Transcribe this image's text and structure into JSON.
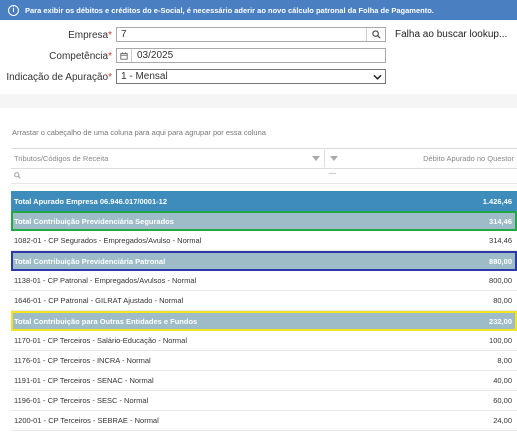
{
  "banner": {
    "icon": "info-icon",
    "text": "Para exibir os débitos e créditos do e-Social, é necessário aderir ao novo cálculo patronal da Folha de Pagamento."
  },
  "form": {
    "empresa_label": "Empresa",
    "empresa_value": "7",
    "lookup_error": "Falha ao buscar lookup...",
    "competencia_label": "Competência",
    "competencia_value": "03/2025",
    "apuracao_label": "Indicação de Apuração",
    "apuracao_value": "1 - Mensal",
    "required_mark": "*"
  },
  "grid": {
    "group_hint": "Arrastar o cabeçalho de uma coluna para aqui para agrupar por essa coluna",
    "col_tributos": "Tributos/Códigos de Receita",
    "col_debito": "Débito Apurado no Questor",
    "filter_minus": "—",
    "total": {
      "name": "Total Apurado Empresa 06.946.017/0001-12",
      "value": "1.426,46"
    },
    "rows": [
      {
        "name": "Total Contribuição Previdenciária Segurados",
        "value": "314,46",
        "kind": "sub",
        "hl": "green"
      },
      {
        "name": "1082-01 - CP Segurados - Empregados/Avulso - Normal",
        "value": "314,46",
        "kind": "normal"
      },
      {
        "name": "Total Contribuição Previdenciária Patronal",
        "value": "880,00",
        "kind": "sub",
        "hl": "blue"
      },
      {
        "name": "1138-01 - CP Patronal - Empregados/Avulsos - Normal",
        "value": "800,00",
        "kind": "normal"
      },
      {
        "name": "1646-01 - CP Patronal - GILRAT Ajustado - Normal",
        "value": "80,00",
        "kind": "normal"
      },
      {
        "name": "Total Contribuição para Outras Entidades e Fundos",
        "value": "232,00",
        "kind": "sub",
        "hl": "yellow"
      },
      {
        "name": "1170-01 - CP Terceiros - Salário-Educação - Normal",
        "value": "100,00",
        "kind": "normal"
      },
      {
        "name": "1176-01 - CP Terceiros - INCRA - Normal",
        "value": "8,00",
        "kind": "normal"
      },
      {
        "name": "1191-01 - CP Terceiros - SENAC - Normal",
        "value": "40,00",
        "kind": "normal"
      },
      {
        "name": "1196-01 - CP Terceiros - SESC - Normal",
        "value": "60,00",
        "kind": "normal"
      },
      {
        "name": "1200-01 - CP Terceiros - SEBRAE - Normal",
        "value": "24,00",
        "kind": "normal"
      }
    ]
  },
  "colors": {
    "banner": "#4a7fc1",
    "total_row": "#3d8cbc",
    "subtotal_row": "#9dbcc7",
    "highlight_green": "#22a845",
    "highlight_blue": "#2b3aa6",
    "highlight_yellow": "#f0e51f"
  }
}
